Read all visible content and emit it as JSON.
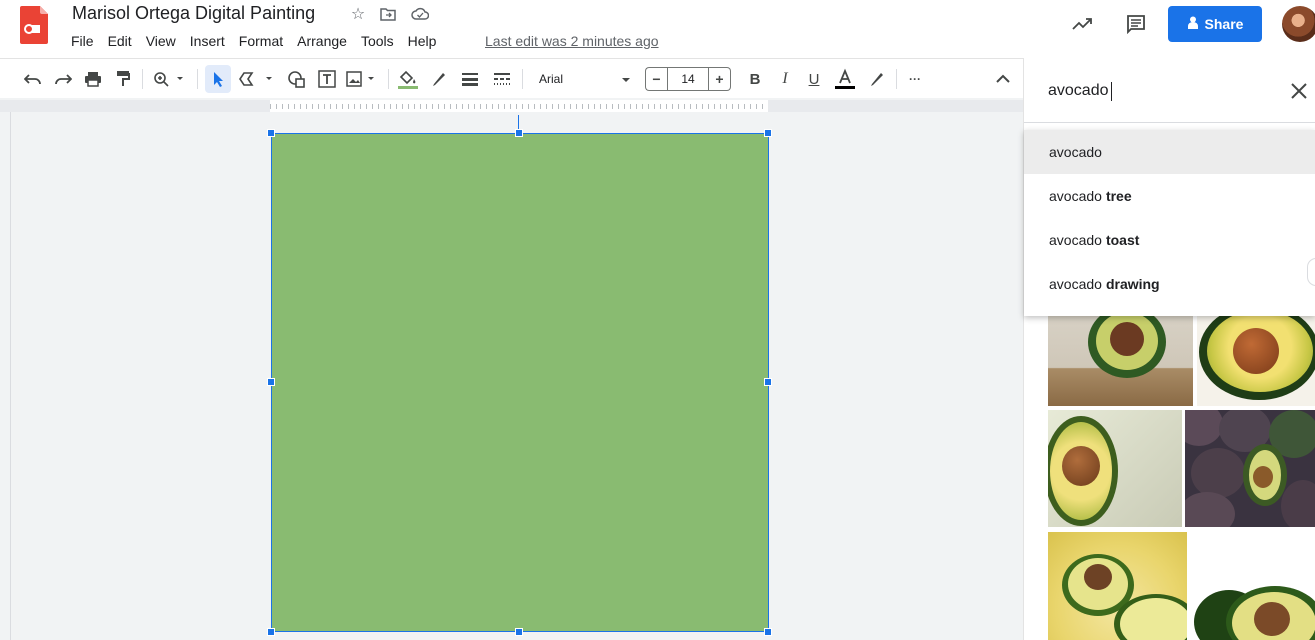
{
  "header": {
    "title": "Marisol Ortega Digital Painting",
    "menu": [
      "File",
      "Edit",
      "View",
      "Insert",
      "Format",
      "Arrange",
      "Tools",
      "Help"
    ],
    "last_edit": "Last edit was 2 minutes ago",
    "share_label": "Share"
  },
  "toolbar": {
    "font": "Arial",
    "font_size": "14",
    "minus": "−",
    "plus": "+",
    "more": "···"
  },
  "canvas": {
    "shape_fill": "#89bb71",
    "selection_color": "#1a73e8"
  },
  "image_search": {
    "query": "avocado",
    "suggestions": [
      {
        "base": "avocado",
        "bold": ""
      },
      {
        "base": "avocado",
        "bold": "tree"
      },
      {
        "base": "avocado",
        "bold": "toast"
      },
      {
        "base": "avocado",
        "bold": "drawing"
      }
    ]
  },
  "colors": {
    "accent": "#1a73e8",
    "brand_red": "#ea4335"
  }
}
